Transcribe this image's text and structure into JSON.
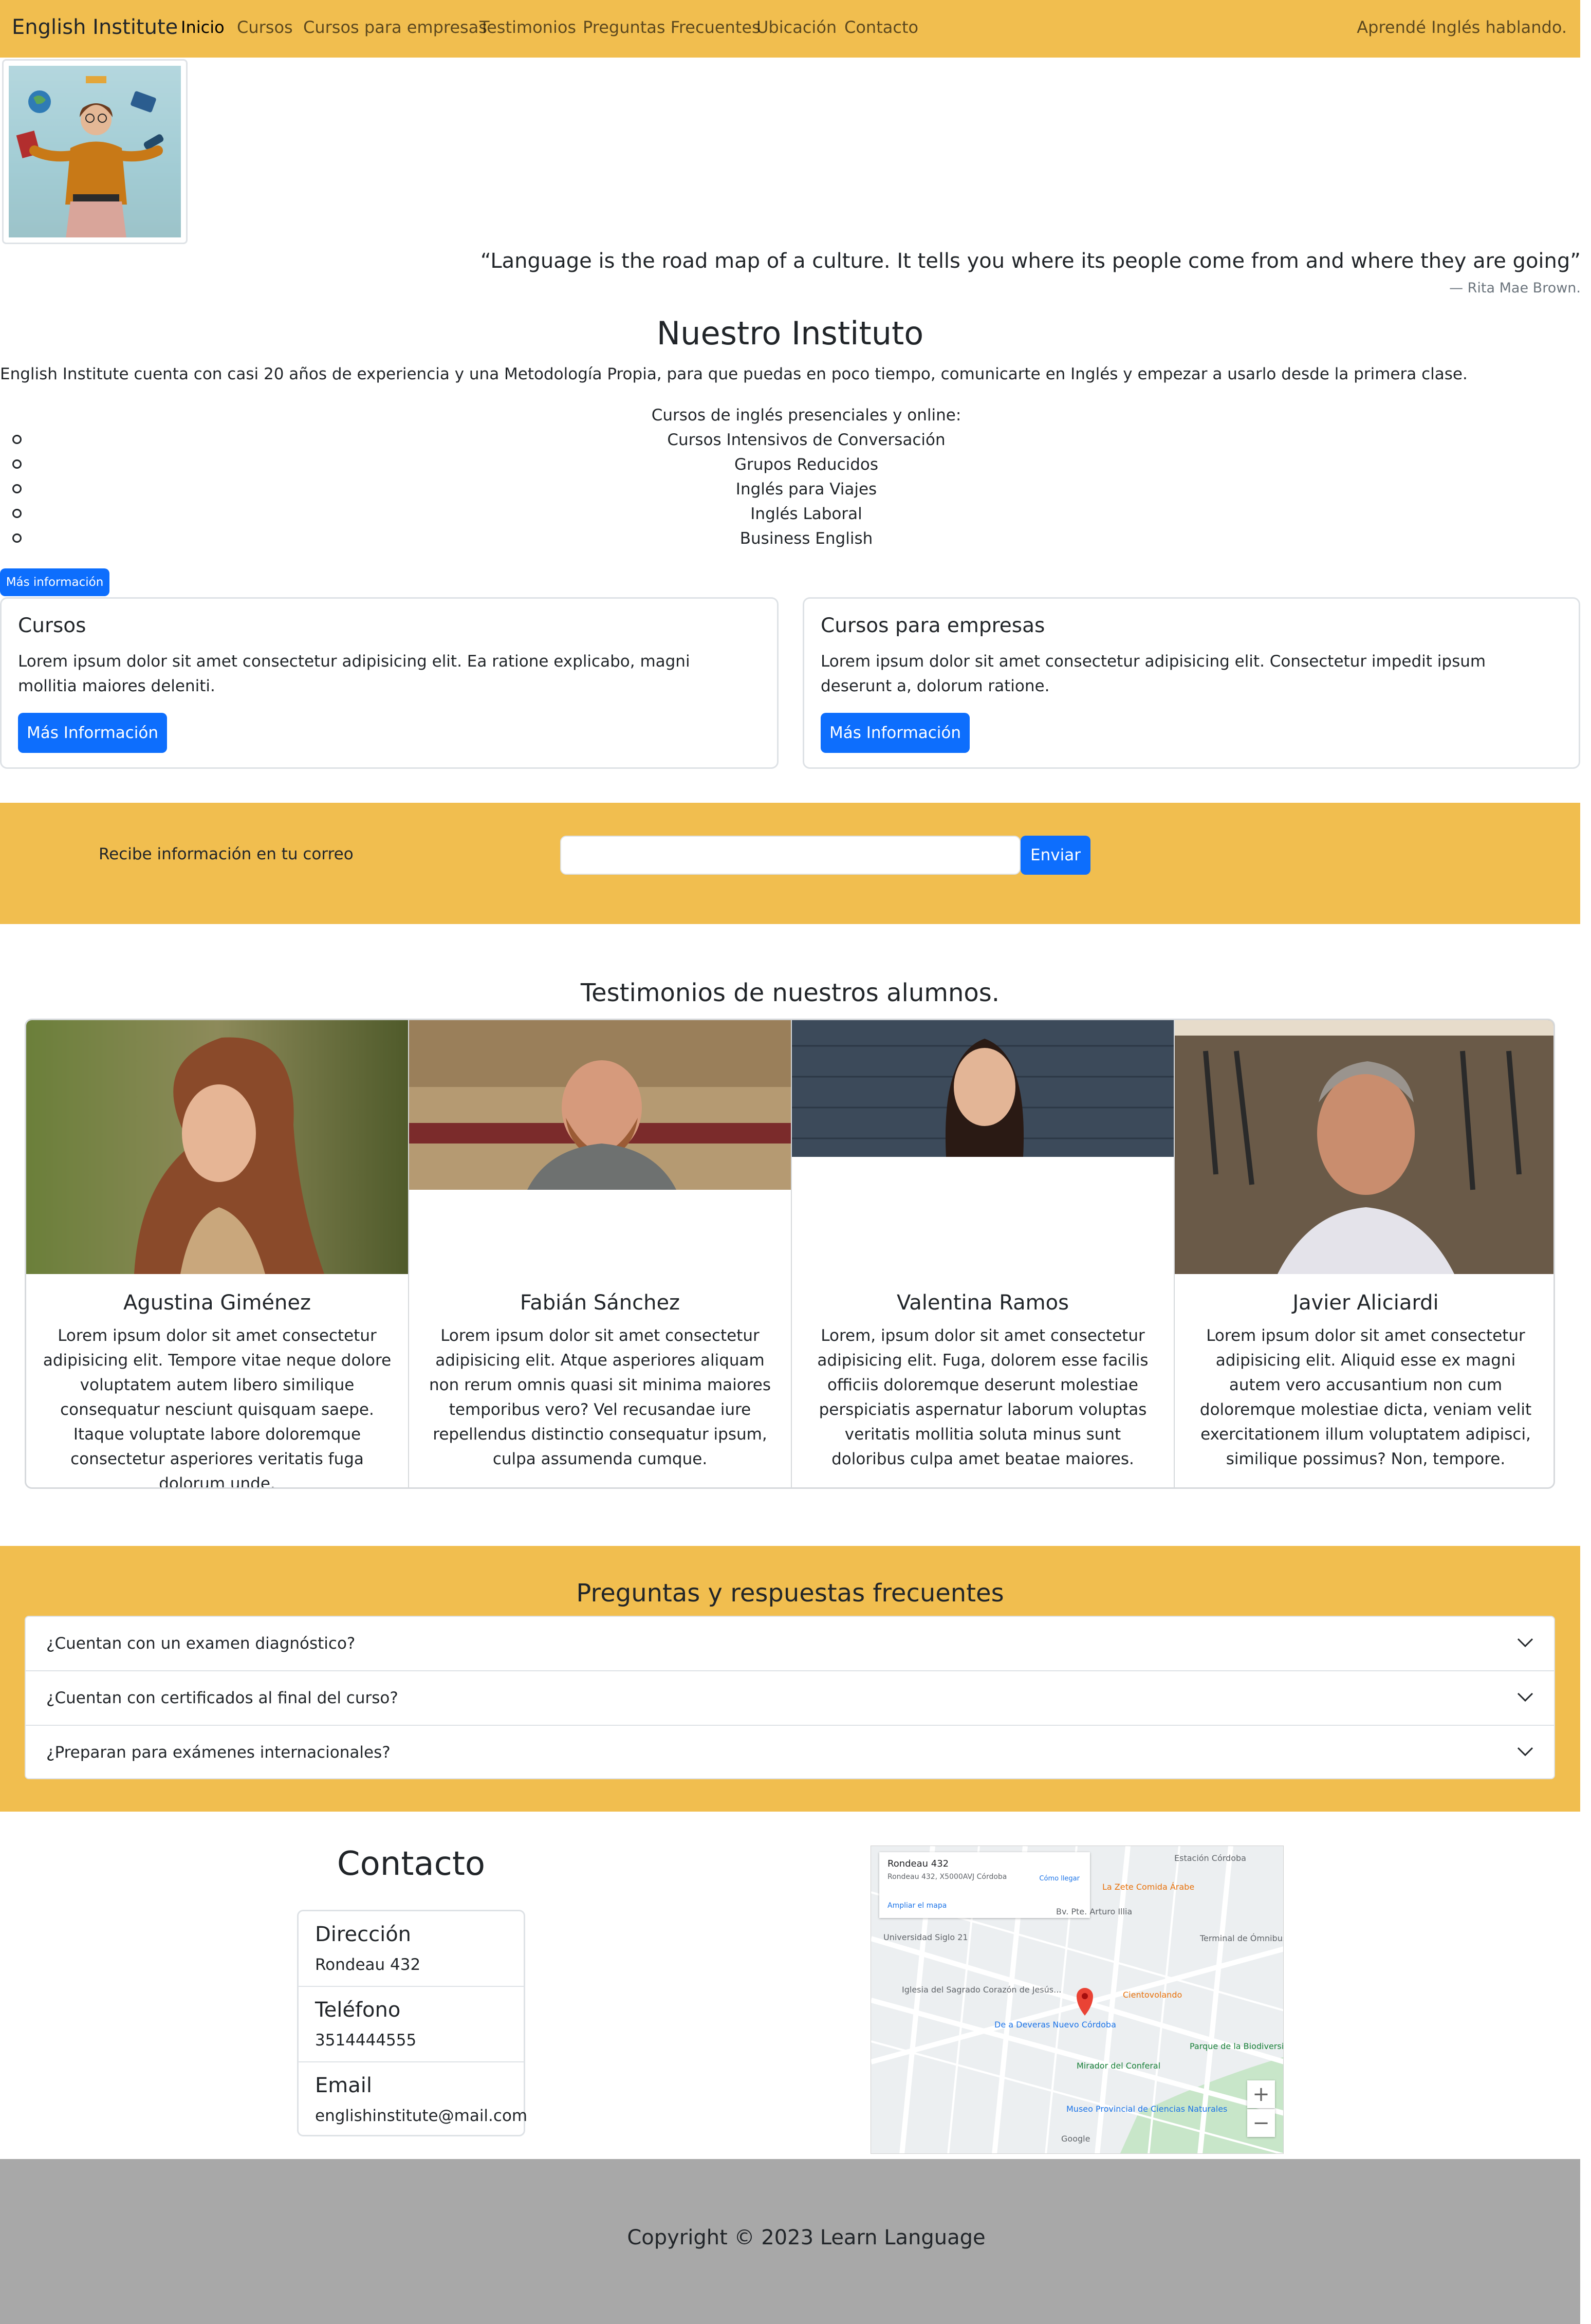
{
  "nav": {
    "brand": "English Institute",
    "links": [
      "Inicio",
      "Cursos",
      "Cursos para empresas",
      "Testimonios",
      "Preguntas Frecuentes",
      "Ubicación",
      "Contacto"
    ],
    "tagline": "Aprendé Inglés hablando."
  },
  "hero": {
    "quote": "“Language is the road map of a culture. It tells you where its people come from and where they are going”",
    "author": "—  Rita Mae Brown."
  },
  "instituto": {
    "title": "Nuestro Instituto",
    "intro": "English Institute cuenta con casi 20 años de experiencia y una Metodología Propia, para que puedas en poco tiempo, comunicarte en Inglés y empezar a usarlo desde la primera clase.",
    "courses_heading": "Cursos de inglés presenciales y online:",
    "courses": [
      "Cursos Intensivos de Conversación",
      "Grupos Reducidos",
      "Inglés para Viajes",
      "Inglés Laboral",
      "Business English"
    ],
    "more_button": "Más información"
  },
  "cards": [
    {
      "title": "Cursos",
      "text": "Lorem ipsum dolor sit amet consectetur adipisicing elit. Ea ratione explicabo, magni mollitia maiores deleniti.",
      "button": "Más Información"
    },
    {
      "title": "Cursos para empresas",
      "text": "Lorem ipsum dolor sit amet consectetur adipisicing elit. Consectetur impedit ipsum deserunt a, dolorum ratione.",
      "button": "Más Información"
    }
  ],
  "newsletter": {
    "label": "Recibe información en tu correo",
    "email_value": "",
    "button": "Enviar"
  },
  "testimonials": {
    "title": "Testimonios de nuestros alumnos.",
    "items": [
      {
        "name": "Agustina Giménez",
        "text": "Lorem ipsum dolor sit amet consectetur adipisicing elit. Tempore vitae neque dolore voluptatem autem libero similique consequatur nesciunt quisquam saepe. Itaque voluptate labore doloremque consectetur asperiores veritatis fuga dolorum unde."
      },
      {
        "name": "Fabián Sánchez",
        "text": "Lorem ipsum dolor sit amet consectetur adipisicing elit. Atque asperiores aliquam non rerum omnis quasi sit minima maiores temporibus vero? Vel recusandae iure repellendus distinctio consequatur ipsum, culpa assumenda cumque."
      },
      {
        "name": "Valentina Ramos",
        "text": "Lorem, ipsum dolor sit amet consectetur adipisicing elit. Fuga, dolorem esse facilis officiis doloremque deserunt molestiae perspiciatis aspernatur laborum voluptas veritatis mollitia soluta minus sunt doloribus culpa amet beatae maiores."
      },
      {
        "name": "Javier Aliciardi",
        "text": "Lorem ipsum dolor sit amet consectetur adipisicing elit. Aliquid esse ex magni autem vero accusantium non cum doloremque molestiae dicta, veniam velit exercitationem illum voluptatem adipisci, similique possimus? Non, tempore."
      }
    ]
  },
  "faq": {
    "title": "Preguntas y respuestas frecuentes",
    "items": [
      "¿Cuentan con un examen diagnóstico?",
      "¿Cuentan con certificados al final del curso?",
      "¿Preparan para exámenes internacionales?"
    ]
  },
  "contact": {
    "title": "Contacto",
    "items": [
      {
        "label": "Dirección",
        "value": "Rondeau 432"
      },
      {
        "label": "Teléfono",
        "value": "3514444555"
      },
      {
        "label": "Email",
        "value": "englishinstitute@mail.com"
      }
    ]
  },
  "map": {
    "title": "Rondeau 432",
    "address": "Rondeau 432, X5000AVJ Córdoba",
    "enlarge": "Ampliar el mapa",
    "directions": "Cómo llegar",
    "labels": [
      "Estación Córdoba",
      "La Zete Comida Árabe",
      "Universidad Siglo 21",
      "Terminal de Ómnibus de Córdoba",
      "Iglesia del Sagrado Corazón de Jesús...",
      "Cientovolando",
      "De a Deveras Nuevo Córdoba",
      "Mirador del Conferal",
      "Parque de la Biodiversidad",
      "Museo Provincial de Ciencias Naturales",
      "Bv. Pte. Arturo Illia",
      "Google"
    ],
    "accent_colors": {
      "pin": "#ea4335",
      "park": "#c8e6c9"
    }
  },
  "footer": {
    "copyright": "Copyright © 2023 Learn Language"
  },
  "colors": {
    "accent": "#f1be4f",
    "primary": "#0d6efd",
    "footer": "#a8a8a8"
  }
}
